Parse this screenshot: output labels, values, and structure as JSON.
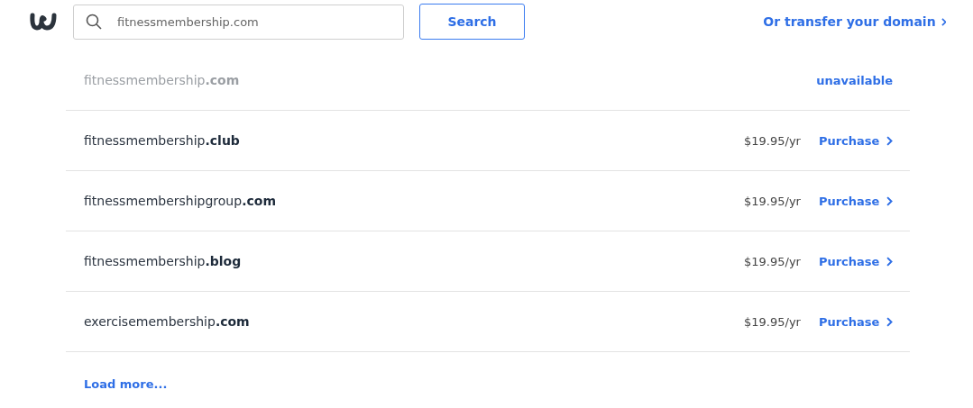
{
  "search": {
    "value": "fitnessmembership.com",
    "button": "Search"
  },
  "transfer_link": "Or transfer your domain",
  "results": [
    {
      "domain": "fitnessmembership**.com**",
      "available": false,
      "status": "unavailable"
    },
    {
      "domain": "fitnessmembership**.club**",
      "available": true,
      "price": "$19.95/yr",
      "action": "Purchase"
    },
    {
      "domain": "fitnessmembershipgroup**.com**",
      "available": true,
      "price": "$19.95/yr",
      "action": "Purchase"
    },
    {
      "domain": "fitnessmembership**.blog**",
      "available": true,
      "price": "$19.95/yr",
      "action": "Purchase"
    },
    {
      "domain": "exercisemembership**.com**",
      "available": true,
      "price": "$19.95/yr",
      "action": "Purchase"
    }
  ],
  "load_more": "Load more..."
}
